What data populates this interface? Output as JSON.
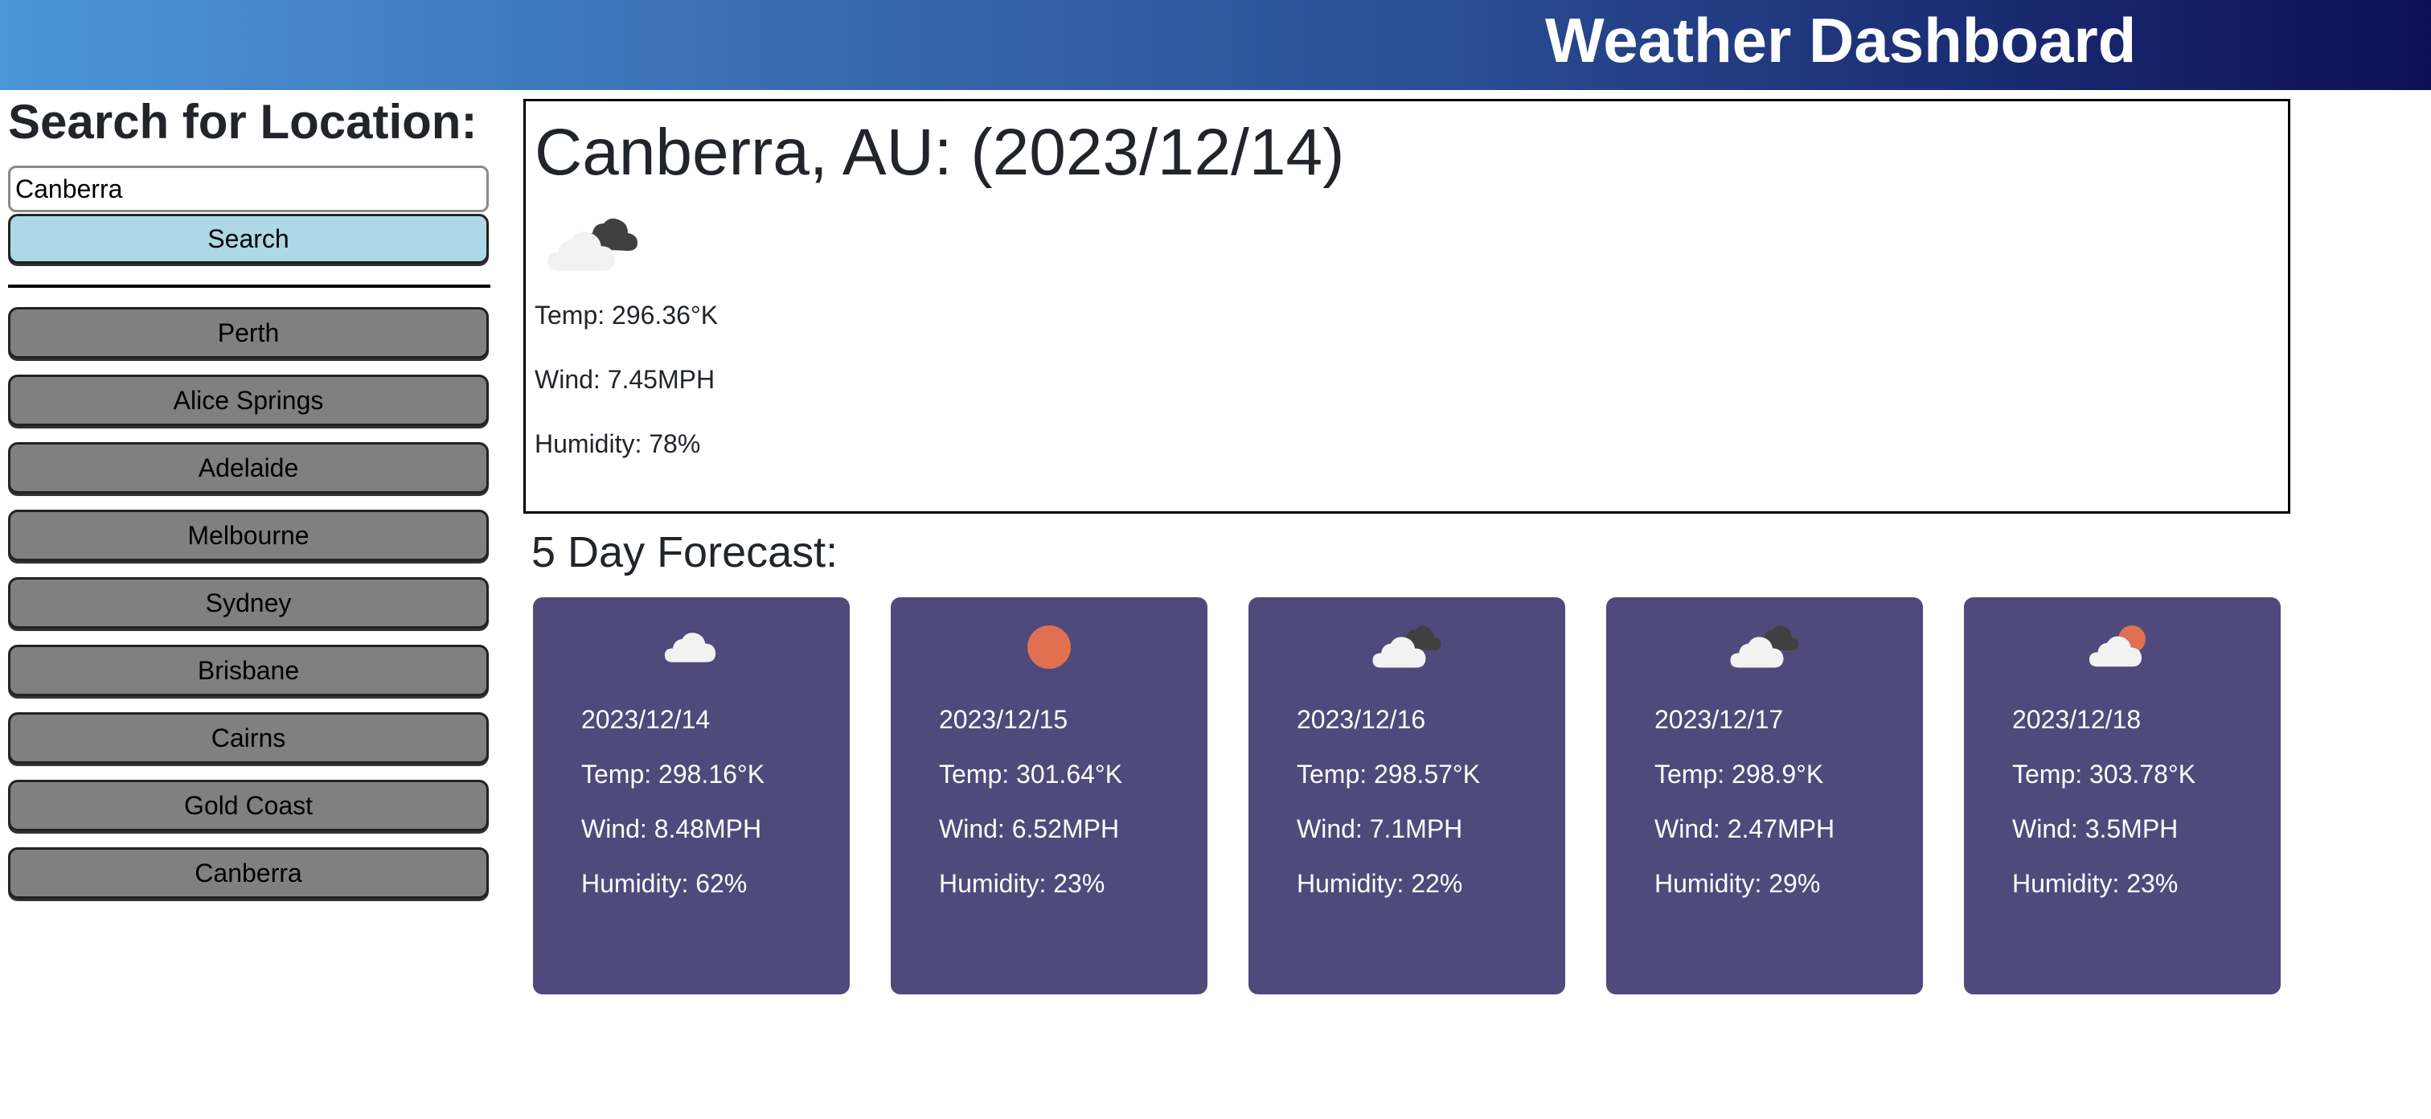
{
  "header": {
    "title": "Weather Dashboard"
  },
  "sidebar": {
    "heading": "Search for Location:",
    "search_value": "Canberra",
    "search_button_label": "Search",
    "history": [
      "Perth",
      "Alice Springs",
      "Adelaide",
      "Melbourne",
      "Sydney",
      "Brisbane",
      "Cairns",
      "Gold Coast",
      "Canberra"
    ]
  },
  "current": {
    "title": "Canberra, AU: (2023/12/14)",
    "icon": "broken-clouds-icon",
    "temp": "Temp: 296.36°K",
    "wind": "Wind: 7.45MPH",
    "humidity": "Humidity: 78%"
  },
  "forecast": {
    "heading": "5 Day Forecast:",
    "days": [
      {
        "icon": "cloud-icon",
        "date": "2023/12/14",
        "temp": "Temp: 298.16°K",
        "wind": "Wind: 8.48MPH",
        "humidity": "Humidity: 62%"
      },
      {
        "icon": "sun-icon",
        "date": "2023/12/15",
        "temp": "Temp: 301.64°K",
        "wind": "Wind: 6.52MPH",
        "humidity": "Humidity: 23%"
      },
      {
        "icon": "broken-clouds-icon",
        "date": "2023/12/16",
        "temp": "Temp: 298.57°K",
        "wind": "Wind: 7.1MPH",
        "humidity": "Humidity: 22%"
      },
      {
        "icon": "broken-clouds-icon",
        "date": "2023/12/17",
        "temp": "Temp: 298.9°K",
        "wind": "Wind: 2.47MPH",
        "humidity": "Humidity: 29%"
      },
      {
        "icon": "partly-cloudy-icon",
        "date": "2023/12/18",
        "temp": "Temp: 303.78°K",
        "wind": "Wind: 3.5MPH",
        "humidity": "Humidity: 23%"
      }
    ]
  },
  "colors": {
    "header_gradient_start": "#4b96d8",
    "header_gradient_end": "#0d0f56",
    "search_button": "#add8e6",
    "history_button": "#808080",
    "forecast_card": "#4f4a7b",
    "sun": "#e07050"
  }
}
